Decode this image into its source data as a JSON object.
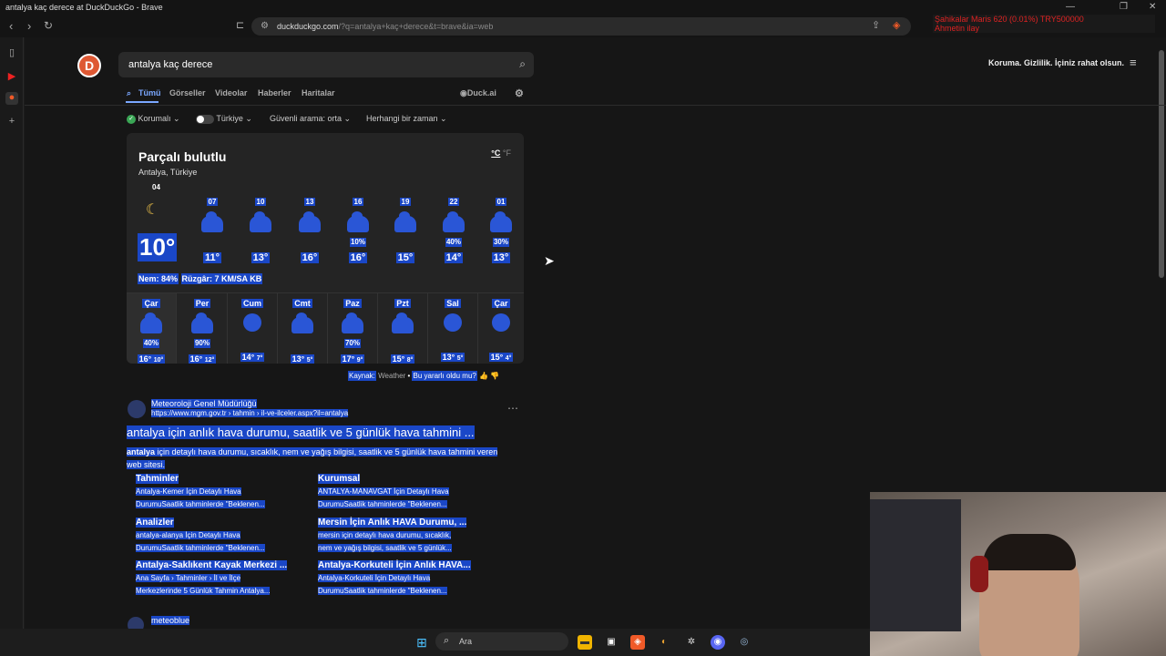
{
  "window": {
    "title": "antalya kaç derece at DuckDuckGo - Brave"
  },
  "toolbar": {
    "url_host": "duckduckgo.com",
    "url_path": "/?q=antalya+kaç+derece&t=brave&ia=web",
    "overlay_line1": "Şahikalar Maris    620 (0.01%)    TRY500000",
    "overlay_line2": "Ahmetin ilay"
  },
  "search": {
    "query": "antalya kaç derece"
  },
  "header": {
    "tagline": "Koruma. Gizlilik. İçiniz rahat olsun."
  },
  "tabs": [
    "Tümü",
    "Görseller",
    "Videolar",
    "Haberler",
    "Haritalar"
  ],
  "duck_ai": "Duck.ai",
  "filters": {
    "protection": "Korumalı",
    "region": "Türkiye",
    "safe_search": "Güvenli arama: orta",
    "time": "Herhangi bir zaman"
  },
  "weather": {
    "condition": "Parçalı bulutlu",
    "location": "Antalya, Türkiye",
    "unit_c": "°C",
    "unit_f": "°F",
    "now_hour": "04",
    "now_temp": "10°",
    "humidity": "Nem: 84%",
    "wind": "Rüzgâr: 7 KM/SA KB",
    "hourly": [
      {
        "h": "07",
        "p": "",
        "t": "11°"
      },
      {
        "h": "10",
        "p": "",
        "t": "13°"
      },
      {
        "h": "13",
        "p": "",
        "t": "16°"
      },
      {
        "h": "16",
        "p": "10%",
        "t": "16°"
      },
      {
        "h": "19",
        "p": "",
        "t": "15°"
      },
      {
        "h": "22",
        "p": "40%",
        "t": "14°"
      },
      {
        "h": "01",
        "p": "30%",
        "t": "13°"
      }
    ],
    "daily": [
      {
        "d": "Çar",
        "p": "40%",
        "hi": "16°",
        "lo": "10°",
        "icon": "cloud-rain-icon"
      },
      {
        "d": "Per",
        "p": "90%",
        "hi": "16°",
        "lo": "12°",
        "icon": "cloud-rain-icon"
      },
      {
        "d": "Cum",
        "p": "",
        "hi": "14°",
        "lo": "7°",
        "icon": "sun-icon"
      },
      {
        "d": "Cmt",
        "p": "",
        "hi": "13°",
        "lo": "5°",
        "icon": "partly-cloudy-icon"
      },
      {
        "d": "Paz",
        "p": "70%",
        "hi": "17°",
        "lo": "9°",
        "icon": "cloud-rain-icon"
      },
      {
        "d": "Pzt",
        "p": "",
        "hi": "15°",
        "lo": "8°",
        "icon": "partly-cloudy-icon"
      },
      {
        "d": "Sal",
        "p": "",
        "hi": "13°",
        "lo": "5°",
        "icon": "sun-icon"
      },
      {
        "d": "Çar",
        "p": "",
        "hi": "15°",
        "lo": "4°",
        "icon": "sun-icon"
      }
    ],
    "source_label": "Kaynak:",
    "source_name": "Weather",
    "feedback": "Bu yararlı oldu mu?"
  },
  "result": {
    "site": "Meteoroloji Genel Müdürlüğü",
    "url": "https://www.mgm.gov.tr › tahmin › il-ve-ilceler.aspx?il=antalya",
    "title": "antalya için anlık hava durumu, saatlik ve 5 günlük hava tahmini ...",
    "snippet_bold": "antalya",
    "snippet": " için detaylı hava durumu, sıcaklık, nem ve yağış bilgisi, saatlik ve 5 günlük hava tahmini veren web sitesi.",
    "sitelinks": [
      {
        "h": "Tahminler",
        "l1": "Antalya-Kemer İçin Detaylı Hava",
        "l2": "DurumuSaatlik tahminlerde \"Beklenen..."
      },
      {
        "h": "Kurumsal",
        "l1": "ANTALYA-MANAVGAT İçin Detaylı Hava",
        "l2": "DurumuSaatlik tahminlerde \"Beklenen..."
      },
      {
        "h": "Analizler",
        "l1": "antalya-alanya İçin Detaylı Hava",
        "l2": "DurumuSaatlik tahminlerde \"Beklenen..."
      },
      {
        "h": "Mersin İçin Anlık HAVA Durumu, ...",
        "l1": "mersin için detaylı hava durumu, sıcaklık,",
        "l2": "nem ve yağış bilgisi, saatlik ve 5 günlük..."
      },
      {
        "h": "Antalya-Saklıkent Kayak Merkezi ...",
        "l1": "Ana Sayfa › Tahminler › İl ve İlçe",
        "l2": "Merkezlerinde 5 Günlük Tahmin Antalya..."
      },
      {
        "h": "Antalya-Korkuteli İçin Anlık HAVA...",
        "l1": "Antalya-Korkuteli İçin Detaylı Hava",
        "l2": "DurumuSaatlik tahminlerde \"Beklenen..."
      }
    ],
    "next_site": "meteoblue"
  },
  "taskbar": {
    "search": "Ara"
  }
}
